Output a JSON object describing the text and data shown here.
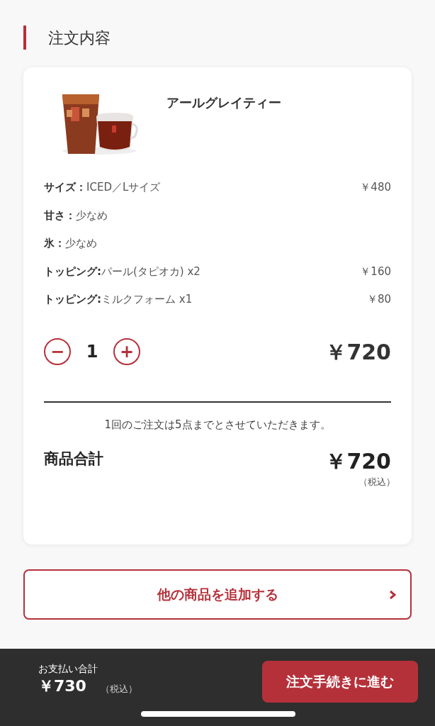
{
  "section_title": "注文内容",
  "item": {
    "name": "アールグレイティー",
    "options": [
      {
        "label": "サイズ：",
        "value": "ICED／Lサイズ",
        "price": "￥480"
      },
      {
        "label": "甘さ：",
        "value": "少なめ"
      },
      {
        "label": "氷：",
        "value": "少なめ"
      },
      {
        "label": "トッピング:",
        "value": "パール(タピオカ) x2",
        "price": "￥160"
      },
      {
        "label": "トッピング:",
        "value": "ミルクフォーム x1",
        "price": "￥80"
      }
    ],
    "quantity": {
      "minus": "−",
      "count": "1",
      "plus": "+"
    },
    "item_price": "￥720"
  },
  "notice": "1回のご注文は5点までとさせていただきます。",
  "subtotal": {
    "label": "商品合計",
    "amount": "￥720",
    "tax_note": "（税込）"
  },
  "add_button": {
    "label": "他の商品を追加する"
  },
  "bottom_bar": {
    "label": "お支払い合計",
    "amount": "￥730",
    "tax_note": "（税込）",
    "button": "注文手続きに進む"
  }
}
